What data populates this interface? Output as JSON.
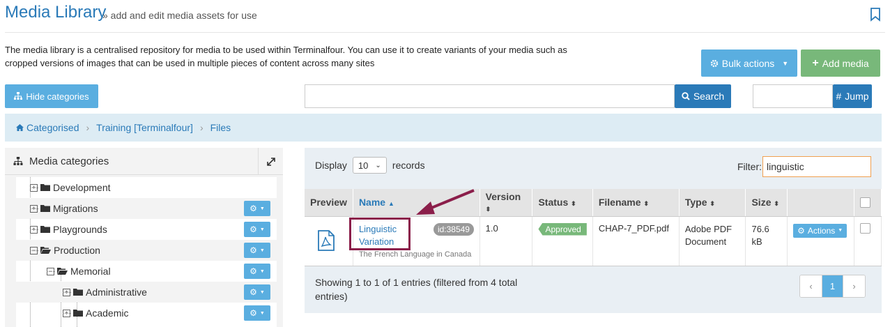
{
  "header": {
    "title": "Media Library",
    "subtitle": "» add and edit media assets for use",
    "intro": "The media library is a centralised repository for media to be used within Terminalfour. You can use it to create variants of your media such as cropped versions of images that can be used in multiple pieces of content across many sites"
  },
  "toolbar": {
    "bulk_label": "Bulk actions",
    "add_label": "Add media",
    "hide_categories_label": "Hide categories",
    "search_value": "",
    "search_label": "Search",
    "jump_value": "",
    "jump_label": "Jump"
  },
  "breadcrumb": {
    "items": [
      "Categorised",
      "Training [Terminalfour]",
      "Files"
    ]
  },
  "categories": {
    "title": "Media categories",
    "items": [
      {
        "label": "Development",
        "toggle": "+"
      },
      {
        "label": "Migrations",
        "toggle": "+"
      },
      {
        "label": "Playgrounds",
        "toggle": "+"
      },
      {
        "label": "Production",
        "toggle": "−"
      },
      {
        "label": "Memorial",
        "toggle": "−"
      },
      {
        "label": "Administrative",
        "toggle": "+"
      },
      {
        "label": "Academic",
        "toggle": "+"
      }
    ]
  },
  "table": {
    "display_label": "Display",
    "display_value": "10",
    "records_label": "records",
    "filter_label": "Filter:",
    "filter_value": "linguistic",
    "columns": [
      "Preview",
      "Name",
      "Version",
      "Status",
      "Filename",
      "Type",
      "Size",
      ""
    ],
    "row": {
      "name_line1": "Linguistic",
      "name_line2": "Variation",
      "id": "id:38549",
      "description": "The French Language in Canada",
      "version": "1.0",
      "status": "Approved",
      "filename": "CHAP-7_PDF.pdf",
      "type": "Adobe PDF Document",
      "size": "76.6 kB",
      "actions_label": "Actions"
    },
    "showing": "Showing 1 to 1 of 1 entries (filtered from 4 total entries)",
    "pager": {
      "prev": "‹",
      "page": "1",
      "next": "›"
    }
  },
  "colors": {
    "primary": "#2a7ab8",
    "button": "#5aaee0",
    "success": "#78b87a",
    "annotation": "#8b1e4a"
  }
}
